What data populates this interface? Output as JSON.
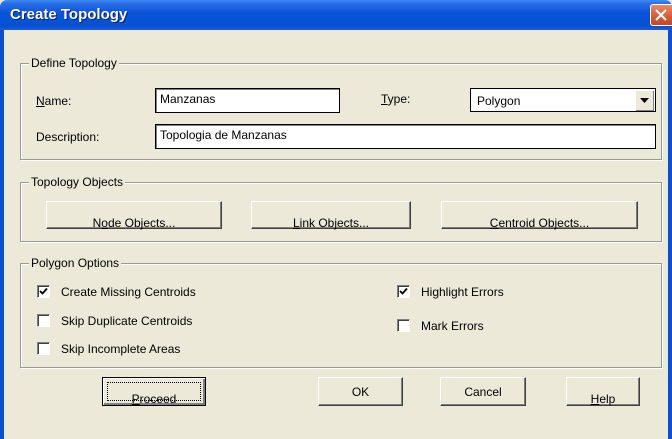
{
  "window": {
    "title": "Create Topology"
  },
  "define_topology": {
    "legend": "Define Topology",
    "name_label_prefix": "",
    "name_label_accel": "N",
    "name_label_rest": "ame:",
    "name_value": "Manzanas",
    "type_label_accel": "T",
    "type_label_rest": "ype:",
    "type_value": "Polygon",
    "description_label": "Description:",
    "description_value": "Topologia de Manzanas"
  },
  "topology_objects": {
    "legend": "Topology Objects",
    "node_prefix": "N",
    "node_accel": "o",
    "node_rest": "de Objects...",
    "link_accel": "L",
    "link_rest": "ink Objects...",
    "centroid_accel": "C",
    "centroid_rest": "entroid Objects..."
  },
  "polygon_options": {
    "legend": "Polygon Options",
    "create_missing_centroids": {
      "label": "Create Missing Centroids",
      "checked": true
    },
    "skip_duplicate_centroids": {
      "label": "Skip Duplicate Centroids",
      "checked": false
    },
    "skip_incomplete_areas": {
      "label": "Skip Incomplete Areas",
      "checked": false
    },
    "highlight_errors": {
      "label": "Highlight Errors",
      "checked": true
    },
    "mark_errors": {
      "label": "Mark Errors",
      "checked": false
    }
  },
  "buttons": {
    "proceed_accel": "P",
    "proceed_rest": "roceed",
    "ok": "OK",
    "cancel": "Cancel",
    "help_accel": "H",
    "help_rest": "elp"
  },
  "colors": {
    "titlebar": "#0a53d8",
    "face": "#ece9d8",
    "close": "#d45a32"
  },
  "icons": {
    "close": "close-icon",
    "dropdown": "chevron-down-icon",
    "check": "checkmark-icon"
  }
}
